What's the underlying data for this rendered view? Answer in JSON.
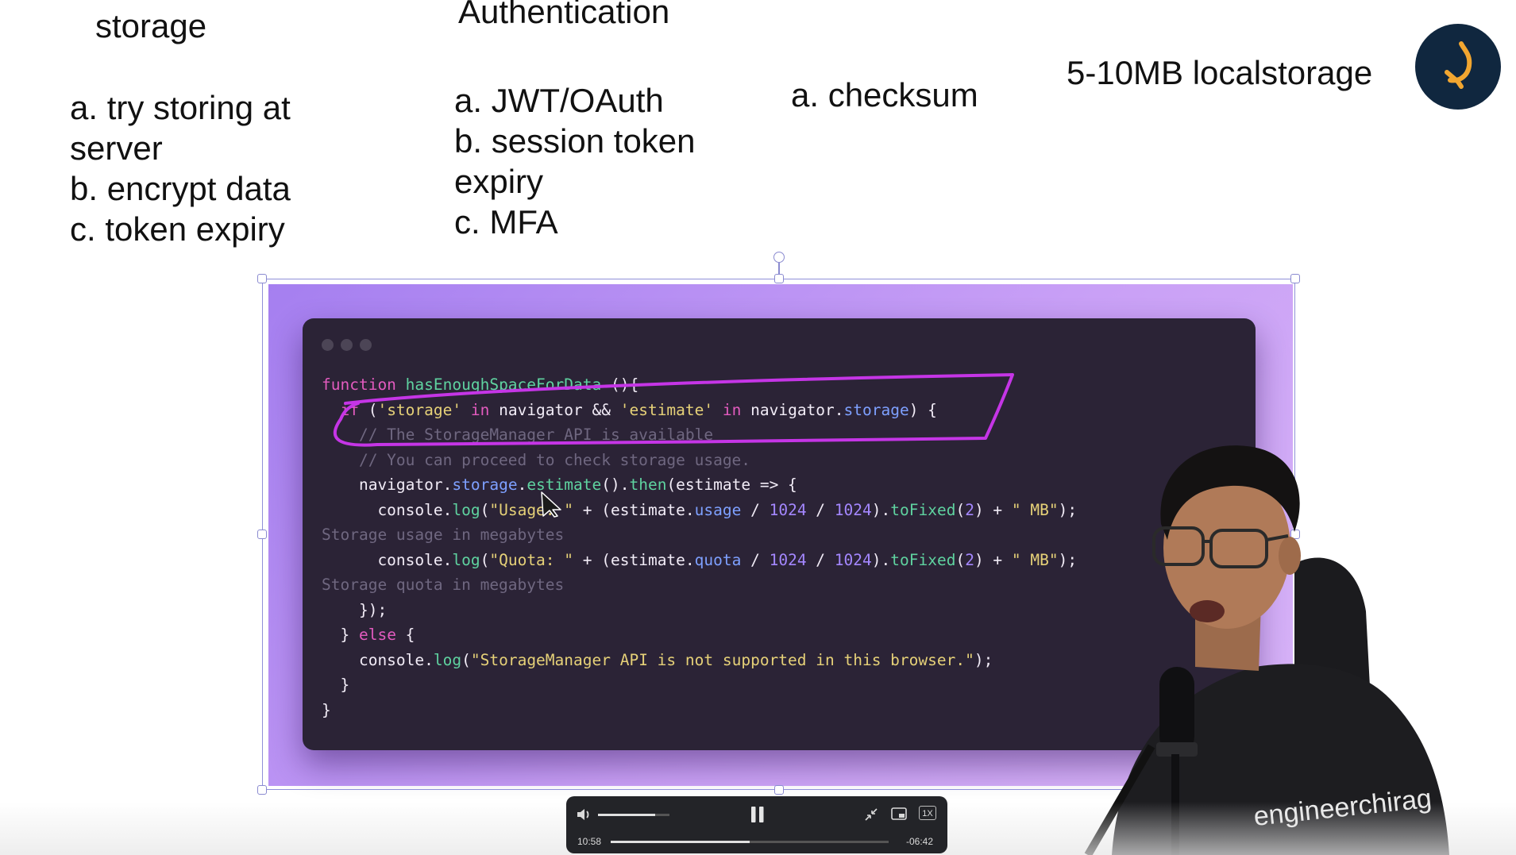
{
  "slide": {
    "col1": {
      "heading": "storage",
      "items": [
        "a. try storing at",
        "server",
        "b. encrypt data",
        "c. token expiry"
      ]
    },
    "col2": {
      "heading": "Authentication",
      "items": [
        "a. JWT/OAuth",
        "b. session token",
        "expiry",
        "c. MFA"
      ]
    },
    "col3": {
      "items": [
        "a. checksum"
      ]
    },
    "col4": {
      "items": [
        "5-10MB localstorage"
      ]
    }
  },
  "code_lines": [
    [
      [
        "kw",
        "function "
      ],
      [
        "fn",
        "hasEnoughSpaceForData"
      ],
      [
        "p",
        " (){"
      ]
    ],
    [
      [
        "p",
        "  "
      ],
      [
        "kw",
        "if"
      ],
      [
        "p",
        " ("
      ],
      [
        "str",
        "'storage'"
      ],
      [
        "p",
        " "
      ],
      [
        "kw",
        "in"
      ],
      [
        "p",
        " navigator && "
      ],
      [
        "str",
        "'estimate'"
      ],
      [
        "p",
        " "
      ],
      [
        "kw",
        "in"
      ],
      [
        "p",
        " navigator."
      ],
      [
        "prop",
        "storage"
      ],
      [
        "p",
        ") {"
      ]
    ],
    [
      [
        "cm",
        "    // The StorageManager API is available"
      ]
    ],
    [
      [
        "cm",
        "    // You can proceed to check storage usage."
      ]
    ],
    [
      [
        "p",
        "    navigator."
      ],
      [
        "prop",
        "storage"
      ],
      [
        "p",
        "."
      ],
      [
        "fn",
        "estimate"
      ],
      [
        "p",
        "()."
      ],
      [
        "fn",
        "then"
      ],
      [
        "p",
        "(estimate => {"
      ]
    ],
    [
      [
        "p",
        "      console."
      ],
      [
        "fn",
        "log"
      ],
      [
        "p",
        "("
      ],
      [
        "str",
        "\"Usage: \""
      ],
      [
        "p",
        " + (estimate."
      ],
      [
        "prop",
        "usage"
      ],
      [
        "p",
        " / "
      ],
      [
        "num",
        "1024"
      ],
      [
        "p",
        " / "
      ],
      [
        "num",
        "1024"
      ],
      [
        "p",
        ")."
      ],
      [
        "fn",
        "toFixed"
      ],
      [
        "p",
        "("
      ],
      [
        "num",
        "2"
      ],
      [
        "p",
        ") + "
      ],
      [
        "str",
        "\" MB\""
      ],
      [
        "p",
        ");"
      ]
    ],
    [
      [
        "cm",
        "Storage usage in megabytes"
      ]
    ],
    [
      [
        "p",
        "      console."
      ],
      [
        "fn",
        "log"
      ],
      [
        "p",
        "("
      ],
      [
        "str",
        "\"Quota: \""
      ],
      [
        "p",
        " + (estimate."
      ],
      [
        "prop",
        "quota"
      ],
      [
        "p",
        " / "
      ],
      [
        "num",
        "1024"
      ],
      [
        "p",
        " / "
      ],
      [
        "num",
        "1024"
      ],
      [
        "p",
        ")."
      ],
      [
        "fn",
        "toFixed"
      ],
      [
        "p",
        "("
      ],
      [
        "num",
        "2"
      ],
      [
        "p",
        ") + "
      ],
      [
        "str",
        "\" MB\""
      ],
      [
        "p",
        ");"
      ]
    ],
    [
      [
        "cm",
        "Storage quota in megabytes"
      ]
    ],
    [
      [
        "p",
        "    });"
      ]
    ],
    [
      [
        "p",
        "  } "
      ],
      [
        "kw",
        "else"
      ],
      [
        "p",
        " {"
      ]
    ],
    [
      [
        "p",
        "    console."
      ],
      [
        "fn",
        "log"
      ],
      [
        "p",
        "("
      ],
      [
        "str",
        "\"StorageManager API is not supported in this browser.\""
      ],
      [
        "p",
        ");"
      ]
    ],
    [
      [
        "p",
        "  }"
      ]
    ],
    [
      [
        "p",
        "}"
      ]
    ]
  ],
  "presenter": {
    "shirt_text": "engineerchirag"
  },
  "player": {
    "current_time": "10:58",
    "remaining_time": "-06:42",
    "speed": "1X",
    "progress_fraction": 0.5,
    "volume_fraction": 0.8,
    "state": "playing"
  },
  "colors": {
    "accent_purple": "#a57ff0",
    "code_bg": "#2b2336",
    "highlight": "#c535e6"
  }
}
